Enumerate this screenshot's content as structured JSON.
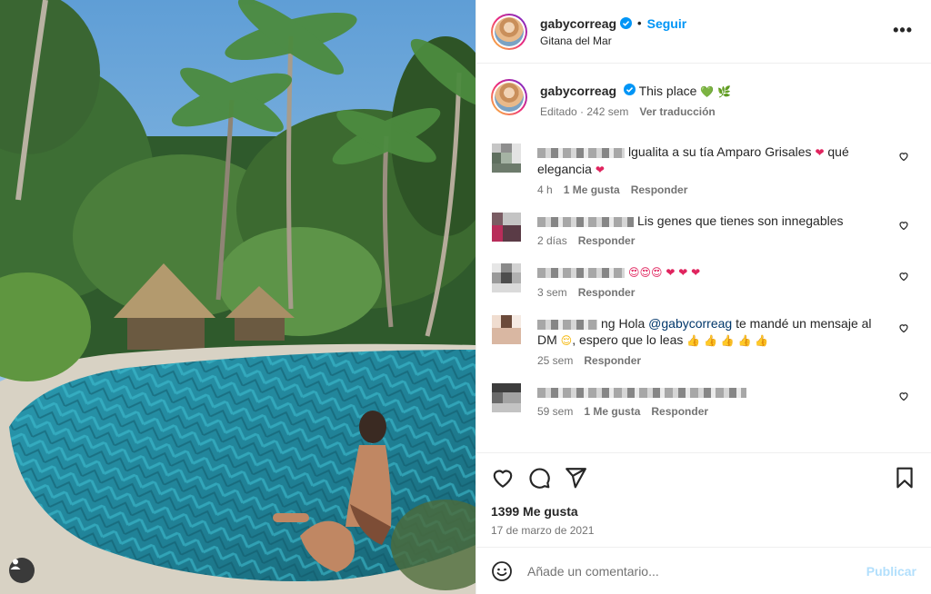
{
  "post": {
    "username": "gabycorreag",
    "follow_label": "Seguir",
    "location": "Gitana del Mar",
    "more_icon": "•••"
  },
  "caption": {
    "username": "gabycorreag",
    "text": "This place",
    "emojis": "💚 🌿",
    "edited": "Editado · 242 sem",
    "translate": "Ver traducción"
  },
  "comments": [
    {
      "text_before": "lgualita a su tía Amparo Grisales",
      "emoji1": "❤",
      "text_after": " qué elegancia",
      "emoji2": "❤",
      "time": "4 h",
      "likes": "1 Me gusta",
      "reply": "Responder"
    },
    {
      "text_before": "Lis genes que tienes son innegables",
      "time": "2 días",
      "reply": "Responder"
    },
    {
      "emojis": "😍😍😍 ❤ ❤ ❤",
      "time": "3 sem",
      "reply": "Responder"
    },
    {
      "text_before": "ng Hola ",
      "mention": "@gabycorreag",
      "text_after": " te mandé un mensaje al DM",
      "emoji_face": "😌",
      "text_after2": ", espero que lo leas",
      "emojis": "👍 👍 👍 👍 👍",
      "time": "25 sem",
      "reply": "Responder"
    },
    {
      "time": "59 sem",
      "likes": "1 Me gusta",
      "reply": "Responder"
    }
  ],
  "actions": {
    "likes": "1399 Me gusta",
    "date": "17 de marzo de 2021"
  },
  "add_comment": {
    "placeholder": "Añade un comentario...",
    "publish": "Publicar"
  },
  "colors": {
    "accent": "#0095f6",
    "publish_disabled": "#b2dffc",
    "text_secondary": "#737373"
  }
}
